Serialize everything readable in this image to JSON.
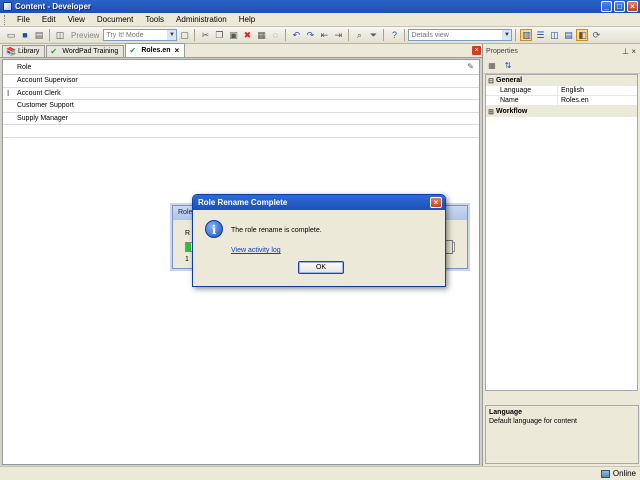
{
  "window": {
    "title": "Content - Developer",
    "buttons": {
      "minimize": "_",
      "maximize": "□",
      "close": "×"
    }
  },
  "menu": [
    "File",
    "Edit",
    "View",
    "Document",
    "Tools",
    "Administration",
    "Help"
  ],
  "toolbar": {
    "preview_label": "Preview",
    "mode_select": "Try It! Mode",
    "view_select": "Details view"
  },
  "tabs": [
    {
      "label": "Library",
      "icon": "library-icon"
    },
    {
      "label": "WordPad Training",
      "icon": "check-icon"
    },
    {
      "label": "Roles.en",
      "icon": "check-icon",
      "active": true,
      "close": "×"
    }
  ],
  "grid": {
    "column_header": "Role",
    "edit_glyph": "✎",
    "rows": [
      "Account Supervisor",
      "Account Clerk",
      "Customer Support",
      "Supply Manager"
    ],
    "cursor_glyph": "I"
  },
  "properties": {
    "title": "Properties",
    "pin_glyphs": "⊥ ×",
    "categories": [
      {
        "name": "General",
        "expander": "⊟",
        "rows": [
          {
            "key": "Language",
            "value": "English"
          },
          {
            "key": "Name",
            "value": "Roles.en"
          }
        ]
      },
      {
        "name": "Workflow",
        "expander": "⊞",
        "rows": []
      }
    ],
    "description": {
      "title": "Language",
      "text": "Default language for content"
    }
  },
  "status": {
    "online": "Online"
  },
  "background_dialog": {
    "title": "Role",
    "progress_label": "R",
    "progress_text": "1",
    "progress_fraction": 0.02
  },
  "dialog": {
    "title": "Role Rename Complete",
    "close": "×",
    "message": "The role rename is complete.",
    "link": "View activity log",
    "ok_label": "OK",
    "icon_glyph": "i"
  },
  "colors": {
    "titlebar": "#2b63c9",
    "link": "#0b3ed1",
    "progress": "#2fbf3a"
  }
}
